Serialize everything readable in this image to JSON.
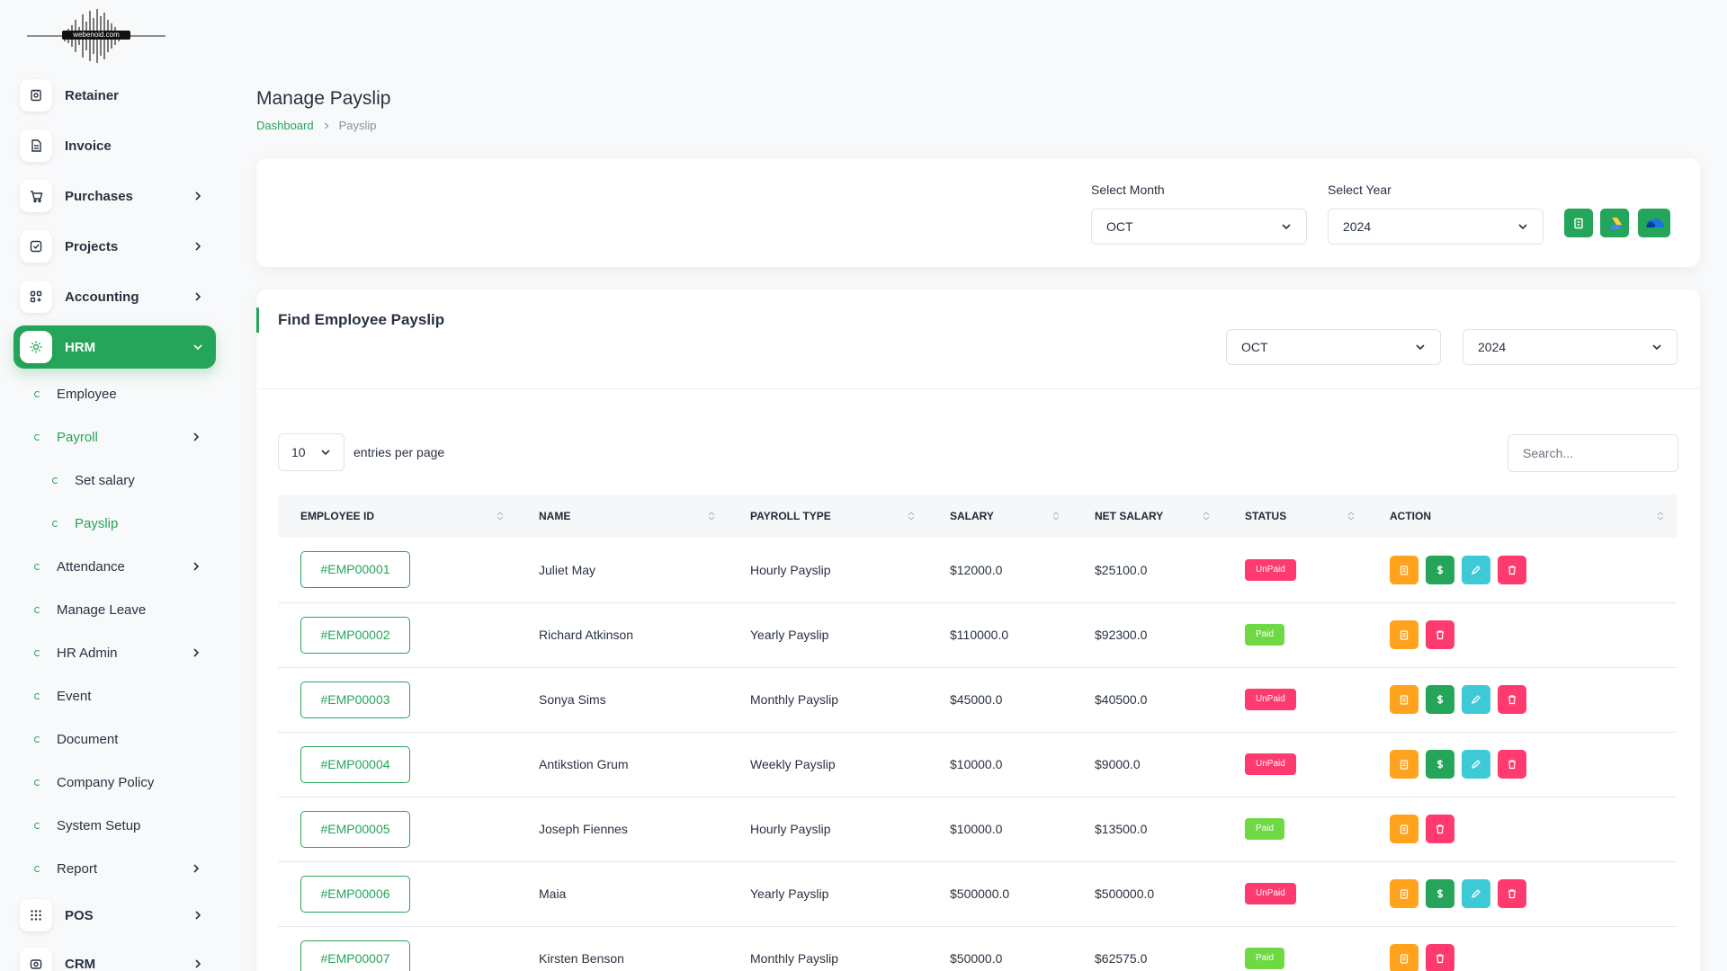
{
  "logo": {
    "text": "webenoid.com"
  },
  "sidebar": {
    "items": [
      {
        "label": "Retainer"
      },
      {
        "label": "Invoice"
      },
      {
        "label": "Purchases"
      },
      {
        "label": "Projects"
      },
      {
        "label": "Accounting"
      },
      {
        "label": "HRM"
      },
      {
        "label": "Employee"
      },
      {
        "label": "Payroll"
      },
      {
        "label": "Set salary"
      },
      {
        "label": "Payslip"
      },
      {
        "label": "Attendance"
      },
      {
        "label": "Manage Leave"
      },
      {
        "label": "HR Admin"
      },
      {
        "label": "Event"
      },
      {
        "label": "Document"
      },
      {
        "label": "Company Policy"
      },
      {
        "label": "System Setup"
      },
      {
        "label": "Report"
      },
      {
        "label": "POS"
      },
      {
        "label": "CRM"
      }
    ]
  },
  "header": {
    "title": "Manage Payslip",
    "breadcrumb": [
      "Dashboard",
      "Payslip"
    ]
  },
  "filter": {
    "month_label": "Select Month",
    "month_value": "OCT",
    "year_label": "Select Year",
    "year_value": "2024"
  },
  "find": {
    "title": "Find Employee Payslip",
    "month_value": "OCT",
    "year_value": "2024"
  },
  "table_controls": {
    "per_page": "10",
    "per_page_label": "entries per page",
    "search_placeholder": "Search..."
  },
  "table": {
    "columns": [
      "EMPLOYEE ID",
      "NAME",
      "PAYROLL TYPE",
      "SALARY",
      "NET SALARY",
      "STATUS",
      "ACTION"
    ],
    "rows": [
      {
        "id": "#EMP00001",
        "name": "Juliet May",
        "type": "Hourly Payslip",
        "salary": "$12000.0",
        "net": "$25100.0",
        "status": "UnPaid"
      },
      {
        "id": "#EMP00002",
        "name": "Richard Atkinson",
        "type": "Yearly Payslip",
        "salary": "$110000.0",
        "net": "$92300.0",
        "status": "Paid"
      },
      {
        "id": "#EMP00003",
        "name": "Sonya Sims",
        "type": "Monthly Payslip",
        "salary": "$45000.0",
        "net": "$40500.0",
        "status": "UnPaid"
      },
      {
        "id": "#EMP00004",
        "name": "Antikstion Grum",
        "type": "Weekly Payslip",
        "salary": "$10000.0",
        "net": "$9000.0",
        "status": "UnPaid"
      },
      {
        "id": "#EMP00005",
        "name": "Joseph Fiennes",
        "type": "Hourly Payslip",
        "salary": "$10000.0",
        "net": "$13500.0",
        "status": "Paid"
      },
      {
        "id": "#EMP00006",
        "name": "Maia",
        "type": "Yearly Payslip",
        "salary": "$500000.0",
        "net": "$500000.0",
        "status": "UnPaid"
      },
      {
        "id": "#EMP00007",
        "name": "Kirsten Benson",
        "type": "Monthly Payslip",
        "salary": "$50000.0",
        "net": "$62575.0",
        "status": "Paid"
      }
    ]
  },
  "colors": {
    "accent": "#25a55a",
    "unpaid": "#ff3a6e",
    "paid": "#6fd943",
    "orange": "#ffa21d",
    "cyan": "#3ec9d6"
  }
}
